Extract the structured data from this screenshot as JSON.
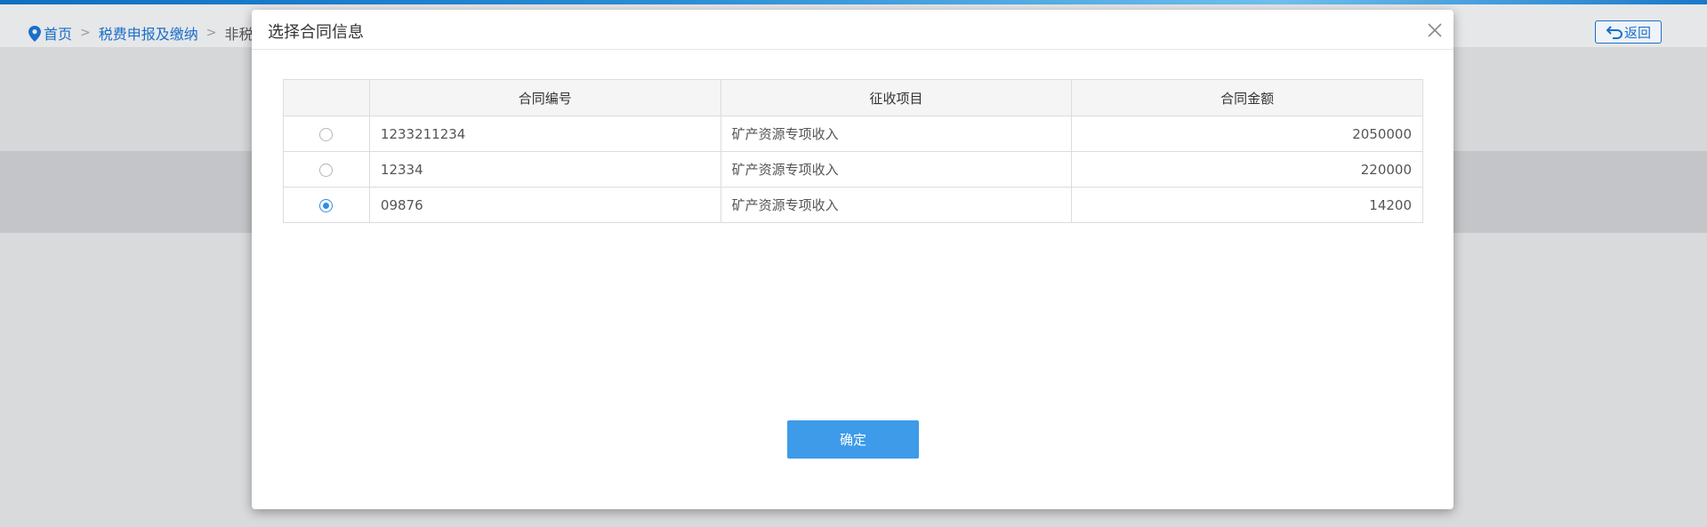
{
  "breadcrumb": {
    "items": [
      {
        "label": "首页"
      },
      {
        "label": "税费申报及缴纳"
      },
      {
        "label": "非税"
      }
    ],
    "separator": ">"
  },
  "header": {
    "back_label": "返回"
  },
  "colors": {
    "accent": "#1a6fc9",
    "button": "#3d9be9",
    "radio_checked": "#2e8ee6"
  },
  "modal": {
    "title": "选择合同信息",
    "confirm_label": "确定",
    "table": {
      "headers": [
        "",
        "合同编号",
        "征收项目",
        "合同金额"
      ],
      "rows": [
        {
          "selected": false,
          "contract_no": "1233211234",
          "item": "矿产资源专项收入",
          "amount": "2050000"
        },
        {
          "selected": false,
          "contract_no": "12334",
          "item": "矿产资源专项收入",
          "amount": "220000"
        },
        {
          "selected": true,
          "contract_no": "09876",
          "item": "矿产资源专项收入",
          "amount": "14200"
        }
      ]
    }
  }
}
